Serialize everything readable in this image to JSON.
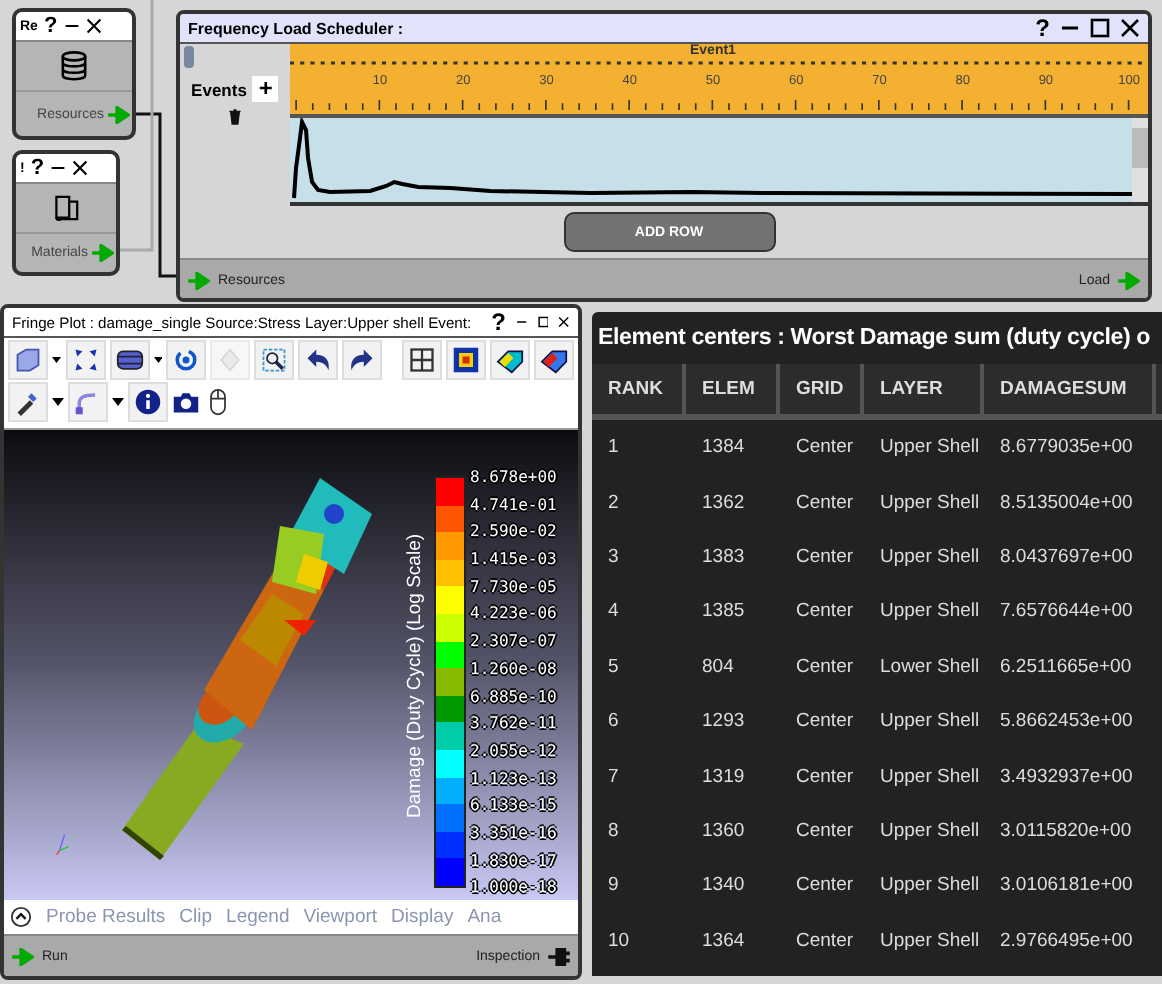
{
  "resources_node": {
    "title": "Re",
    "help": "?",
    "port": "Resources"
  },
  "materials_node": {
    "title": "!",
    "help": "?",
    "port": "Materials"
  },
  "scheduler": {
    "title": "Frequency Load Scheduler :",
    "help": "?",
    "events_label": "Events",
    "add_label": "+",
    "event_name": "Event1",
    "ticks": [
      "10",
      "20",
      "30",
      "40",
      "50",
      "60",
      "70",
      "80",
      "90",
      "100"
    ],
    "add_row": "ADD ROW",
    "input_port": "Resources",
    "output_port": "Load"
  },
  "fringe_plot": {
    "title": "Fringe Plot : damage_single Source:Stress Layer:Upper shell Event:",
    "help": "?",
    "legend_title": "Damage (Duty Cycle) (Log Scale)",
    "legend_labels": [
      "8.678e+00",
      "4.741e-01",
      "2.590e-02",
      "1.415e-03",
      "7.730e-05",
      "4.223e-06",
      "2.307e-07",
      "1.260e-08",
      "6.885e-10",
      "3.762e-11",
      "2.055e-12",
      "1.123e-13",
      "6.133e-15",
      "3.351e-16",
      "1.830e-17",
      "1.000e-18"
    ],
    "legend_bands": [
      {
        "color": "#ff0000"
      },
      {
        "color": "#ff5500"
      },
      {
        "color": "#ff9900"
      },
      {
        "color": "#ffc000"
      },
      {
        "color": "#ffff00"
      },
      {
        "color": "#ccff00"
      },
      {
        "color": "#00ff00"
      },
      {
        "color": "#88bb00"
      },
      {
        "color": "#009900"
      },
      {
        "color": "#00ccaa"
      },
      {
        "color": "#00ffff"
      },
      {
        "color": "#00b0ff"
      },
      {
        "color": "#0070ff"
      },
      {
        "color": "#0030ff"
      },
      {
        "color": "#0000ff"
      }
    ],
    "tabs": [
      "Probe Results",
      "Clip",
      "Legend",
      "Viewport",
      "Display",
      "Ana"
    ],
    "input_port": "Run",
    "output_port": "Inspection"
  },
  "results_table": {
    "title": "Element centers : Worst Damage sum (duty cycle) o",
    "columns": [
      "RANK",
      "ELEM",
      "GRID",
      "LAYER",
      "DAMAGESUM"
    ],
    "rows": [
      [
        "1",
        "1384",
        "Center",
        "Upper Shell",
        "8.6779035e+00"
      ],
      [
        "2",
        "1362",
        "Center",
        "Upper Shell",
        "8.5135004e+00"
      ],
      [
        "3",
        "1383",
        "Center",
        "Upper Shell",
        "8.0437697e+00"
      ],
      [
        "4",
        "1385",
        "Center",
        "Upper Shell",
        "7.6576644e+00"
      ],
      [
        "5",
        "804",
        "Center",
        "Lower Shell",
        "6.2511665e+00"
      ],
      [
        "6",
        "1293",
        "Center",
        "Upper Shell",
        "5.8662453e+00"
      ],
      [
        "7",
        "1319",
        "Center",
        "Upper Shell",
        "3.4932937e+00"
      ],
      [
        "8",
        "1360",
        "Center",
        "Upper Shell",
        "3.0115820e+00"
      ],
      [
        "9",
        "1340",
        "Center",
        "Upper Shell",
        "3.0106181e+00"
      ],
      [
        "10",
        "1364",
        "Center",
        "Upper Shell",
        "2.9766495e+00"
      ]
    ]
  }
}
